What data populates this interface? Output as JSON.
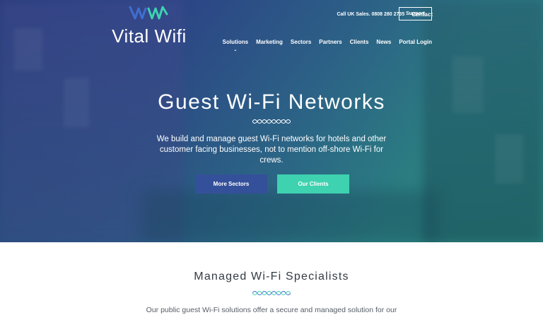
{
  "brand": {
    "name": "Vital Wifi",
    "logo_icon": "wave-logo-icon"
  },
  "header": {
    "call_text": "Call UK Sales. 0808 280 2735",
    "contact_label": "Contact",
    "support_label": "Support"
  },
  "nav": {
    "items": [
      {
        "label": "Solutions"
      },
      {
        "label": "Marketing"
      },
      {
        "label": "Sectors"
      },
      {
        "label": "Partners"
      },
      {
        "label": "Clients"
      },
      {
        "label": "News"
      },
      {
        "label": "Portal Login"
      }
    ],
    "active_index": 0
  },
  "hero": {
    "title": "Guest Wi-Fi Networks",
    "subtitle": "We build and manage guest Wi-Fi networks for hotels and other customer facing businesses, not to mention off-shore Wi-Fi for crews.",
    "primary_button": "More Sectors",
    "secondary_button": "Our Clients"
  },
  "section": {
    "title": "Managed Wi-Fi Specialists",
    "text": "Our public guest Wi-Fi solutions offer a secure and managed solution for our"
  },
  "colors": {
    "primary_blue": "#35509a",
    "accent_teal": "#3ed2b0",
    "wave_blue": "#3f6fd0",
    "wave_teal": "#3ed2b0"
  }
}
